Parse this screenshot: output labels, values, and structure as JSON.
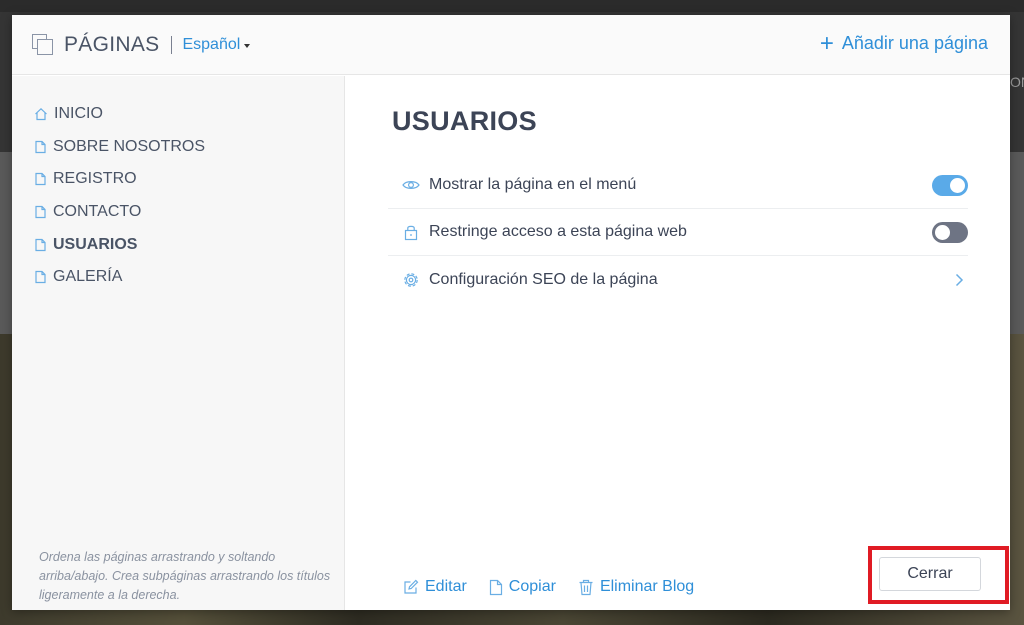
{
  "background": {
    "partial_text": "ON"
  },
  "header": {
    "title": "PÁGINAS",
    "language": "Español",
    "add_page": "Añadir una página"
  },
  "sidebar": {
    "items": [
      {
        "label": "INICIO",
        "icon": "home-icon",
        "active": false
      },
      {
        "label": "SOBRE NOSOTROS",
        "icon": "page-icon",
        "active": false
      },
      {
        "label": "REGISTRO",
        "icon": "page-icon",
        "active": false
      },
      {
        "label": "CONTACTO",
        "icon": "page-icon",
        "active": false
      },
      {
        "label": "USUARIOS",
        "icon": "page-icon",
        "active": true
      },
      {
        "label": "GALERÍA",
        "icon": "page-icon",
        "active": false
      }
    ],
    "hint": "Ordena las páginas arrastrando y soltando arriba/abajo. Crea subpáginas arrastrando los títulos ligeramente a la derecha."
  },
  "main": {
    "title": "USUARIOS",
    "settings": [
      {
        "label": "Mostrar la página en el menú",
        "icon": "eye-icon",
        "control": "toggle",
        "on": true
      },
      {
        "label": "Restringe acceso a esta página web",
        "icon": "lock-icon",
        "control": "toggle",
        "on": false
      },
      {
        "label": "Configuración SEO de la página",
        "icon": "gear-icon",
        "control": "chevron"
      }
    ],
    "actions": {
      "edit": "Editar",
      "copy": "Copiar",
      "delete": "Eliminar Blog"
    },
    "close": "Cerrar"
  },
  "colors": {
    "accent": "#2f8fd8",
    "toggle_on": "#5aaae8",
    "toggle_off": "#6e7484",
    "highlight": "#e01b24"
  }
}
